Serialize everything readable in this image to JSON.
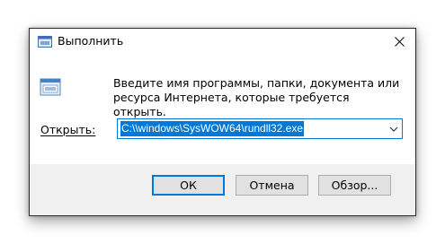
{
  "window": {
    "title": "Выполнить",
    "close_icon": "close-icon"
  },
  "content": {
    "icon": "run-icon",
    "description": "Введите имя программы, папки, документа или ресурса Интернета, которые требуется открыть.",
    "open_label": "Открыть:",
    "open_value": "C:\\\\windows\\SysWOW64\\rundll32.exe",
    "dropdown_icon": "chevron-down-icon"
  },
  "buttons": {
    "ok": "ОК",
    "cancel": "Отмена",
    "browse": "Обзор..."
  },
  "colors": {
    "accent": "#0078d7",
    "dialog_bg": "#f0f0f0",
    "button_bg": "#e1e1e1"
  }
}
